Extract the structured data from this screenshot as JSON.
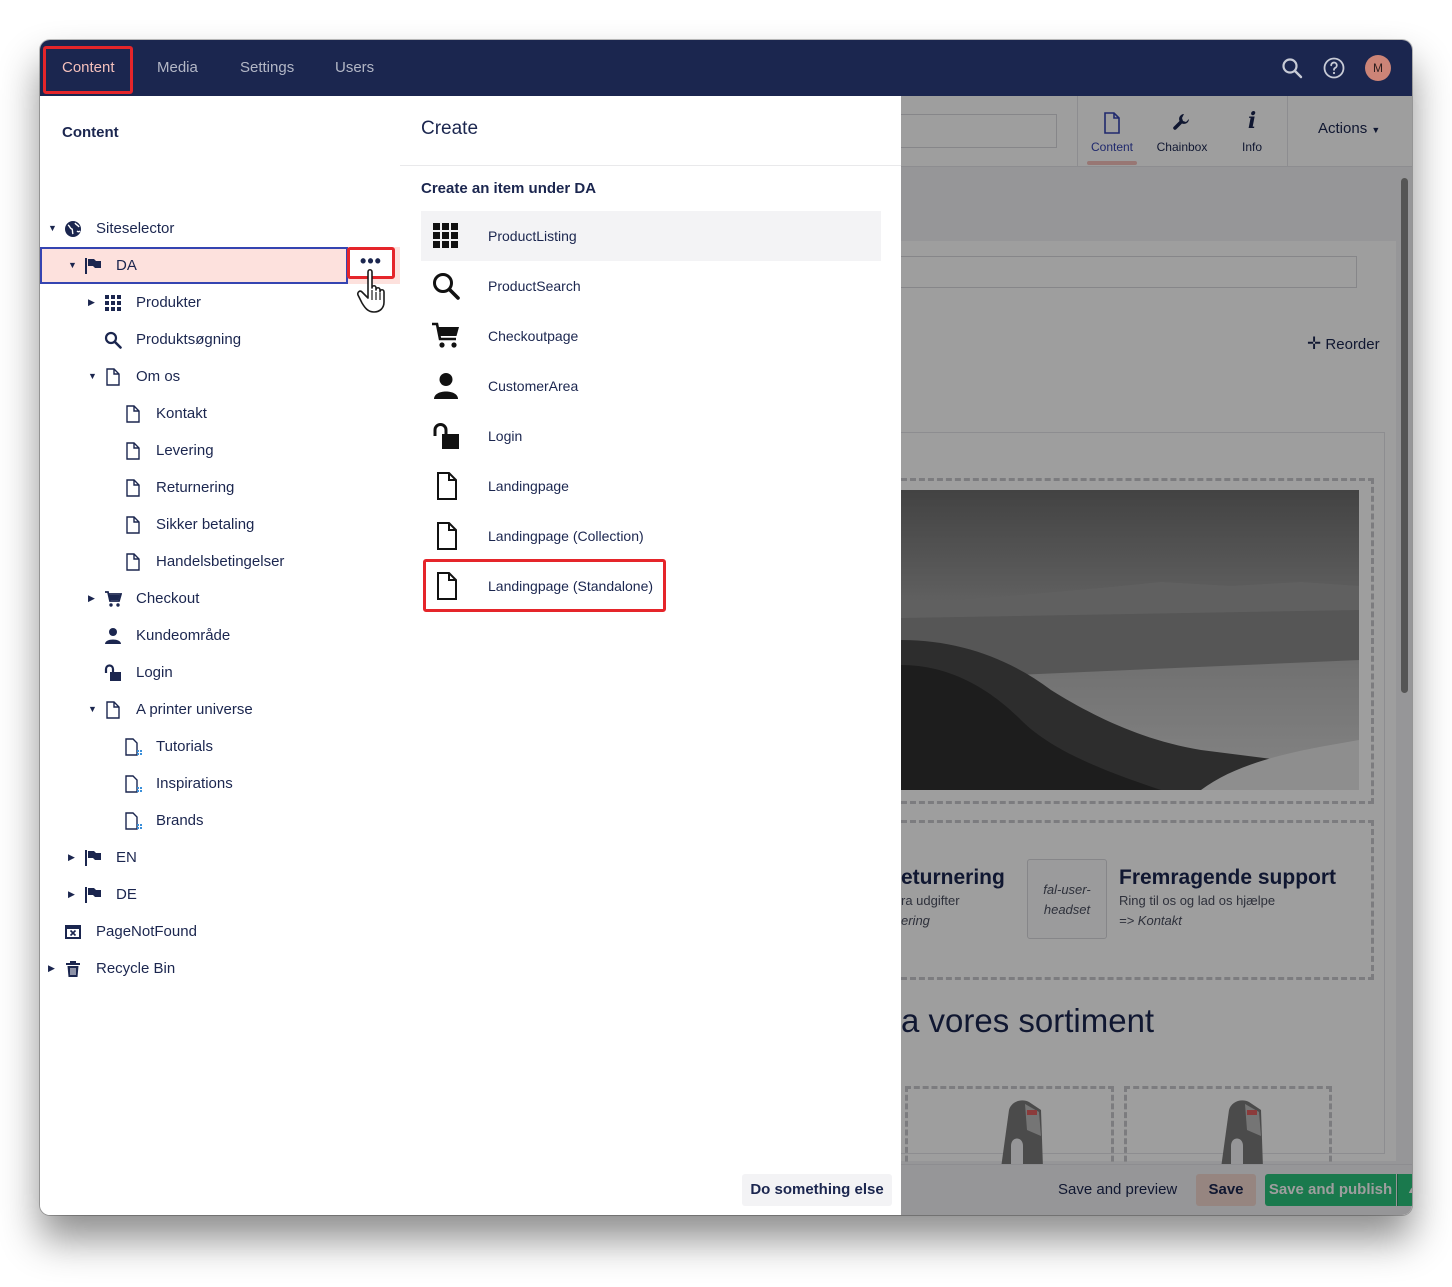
{
  "topnav": {
    "items": [
      {
        "label": "Content",
        "active": true
      },
      {
        "label": "Media"
      },
      {
        "label": "Settings"
      },
      {
        "label": "Users"
      }
    ],
    "avatar_initial": "M",
    "icons": [
      "search-icon",
      "help-icon",
      "user-avatar"
    ]
  },
  "tree": {
    "title": "Content",
    "nodes": [
      {
        "label": "Siteselector",
        "icon": "globe-icon",
        "expanded": true
      },
      {
        "label": "DA",
        "icon": "flag-icon",
        "expanded": true,
        "selected": true
      },
      {
        "label": "Produkter",
        "icon": "grid-icon",
        "expanded": false
      },
      {
        "label": "Produktsøgning",
        "icon": "search-icon"
      },
      {
        "label": "Om os",
        "icon": "document-icon",
        "expanded": true
      },
      {
        "label": "Kontakt",
        "icon": "document-icon"
      },
      {
        "label": "Levering",
        "icon": "document-icon"
      },
      {
        "label": "Returnering",
        "icon": "document-icon"
      },
      {
        "label": "Sikker betaling",
        "icon": "document-icon"
      },
      {
        "label": "Handelsbetingelser",
        "icon": "document-icon"
      },
      {
        "label": "Checkout",
        "icon": "cart-icon",
        "expanded": false
      },
      {
        "label": "Kundeområde",
        "icon": "user-icon"
      },
      {
        "label": "Login",
        "icon": "unlock-icon"
      },
      {
        "label": "A printer universe",
        "icon": "document-icon",
        "expanded": true
      },
      {
        "label": "Tutorials",
        "icon": "document-list-icon"
      },
      {
        "label": "Inspirations",
        "icon": "document-list-icon"
      },
      {
        "label": "Brands",
        "icon": "document-list-icon"
      },
      {
        "label": "EN",
        "icon": "flag-icon",
        "expanded": false
      },
      {
        "label": "DE",
        "icon": "flag-icon",
        "expanded": false
      },
      {
        "label": "PageNotFound",
        "icon": "window-close-icon"
      },
      {
        "label": "Recycle Bin",
        "icon": "trash-icon",
        "expanded": false
      }
    ],
    "actions_button": "•••"
  },
  "create": {
    "title": "Create",
    "subtitle": "Create an item under DA",
    "types": [
      {
        "label": "ProductListing",
        "icon": "grid-icon"
      },
      {
        "label": "ProductSearch",
        "icon": "search-icon"
      },
      {
        "label": "Checkoutpage",
        "icon": "cart-icon"
      },
      {
        "label": "CustomerArea",
        "icon": "user-icon"
      },
      {
        "label": "Login",
        "icon": "unlock-icon"
      },
      {
        "label": "Landingpage",
        "icon": "document-icon"
      },
      {
        "label": "Landingpage (Collection)",
        "icon": "document-icon"
      },
      {
        "label": "Landingpage (Standalone)",
        "icon": "document-icon"
      }
    ],
    "footer_button": "Do something else"
  },
  "editor": {
    "apps": [
      {
        "label": "Content",
        "icon": "document-icon"
      },
      {
        "label": "Chainbox",
        "icon": "wrench-icon"
      },
      {
        "label": "Info",
        "icon": "info-icon"
      }
    ],
    "actions_label": "Actions",
    "reorder_label": "Reorder",
    "usp_1_title": "eturnering",
    "usp_1_text": "ra udgifter",
    "usp_1_link": "ering",
    "usp_2_icon_text": "fal-user-headset",
    "usp_2_title": "Fremragende support",
    "usp_2_text": "Ring til os og lad os hjælpe",
    "usp_2_link": "=> Kontakt",
    "heading": "a vores sortiment",
    "buttons": {
      "preview": "Save and preview",
      "save": "Save",
      "publish": "Save and publish"
    }
  },
  "colors": {
    "topbar": "#1b264f",
    "active_nav": "#f5c1bc",
    "highlight": "#e5252a",
    "selected_row": "#fde1dd",
    "publish": "#2bc37c"
  }
}
